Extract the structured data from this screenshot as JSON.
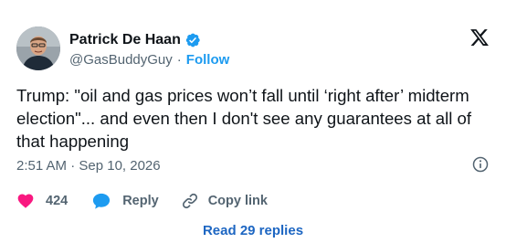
{
  "author": {
    "display_name": "Patrick De Haan",
    "handle": "@GasBuddyGuy",
    "follow_label": "Follow",
    "separator": "·"
  },
  "tweet": {
    "text": "Trump: \"oil and gas prices won’t fall until ‘right after’ midterm election\"... and even then I don't see any guarantees at all of that happening",
    "timestamp": "2:51 AM · Sep 10, 2026"
  },
  "actions": {
    "likes_count": "424",
    "reply_label": "Reply",
    "copy_link_label": "Copy link"
  },
  "footer": {
    "read_replies_label": "Read 29 replies"
  },
  "icons": {
    "verified": "verified-badge-icon",
    "logo": "x-logo-icon",
    "info": "info-icon",
    "like": "heart-icon",
    "reply": "speech-bubble-icon",
    "copy": "link-icon"
  },
  "colors": {
    "accent": "#1d9bf0",
    "like": "#f91880",
    "muted": "#536471",
    "text": "#0f1419",
    "read_replies": "#1d66c2"
  }
}
